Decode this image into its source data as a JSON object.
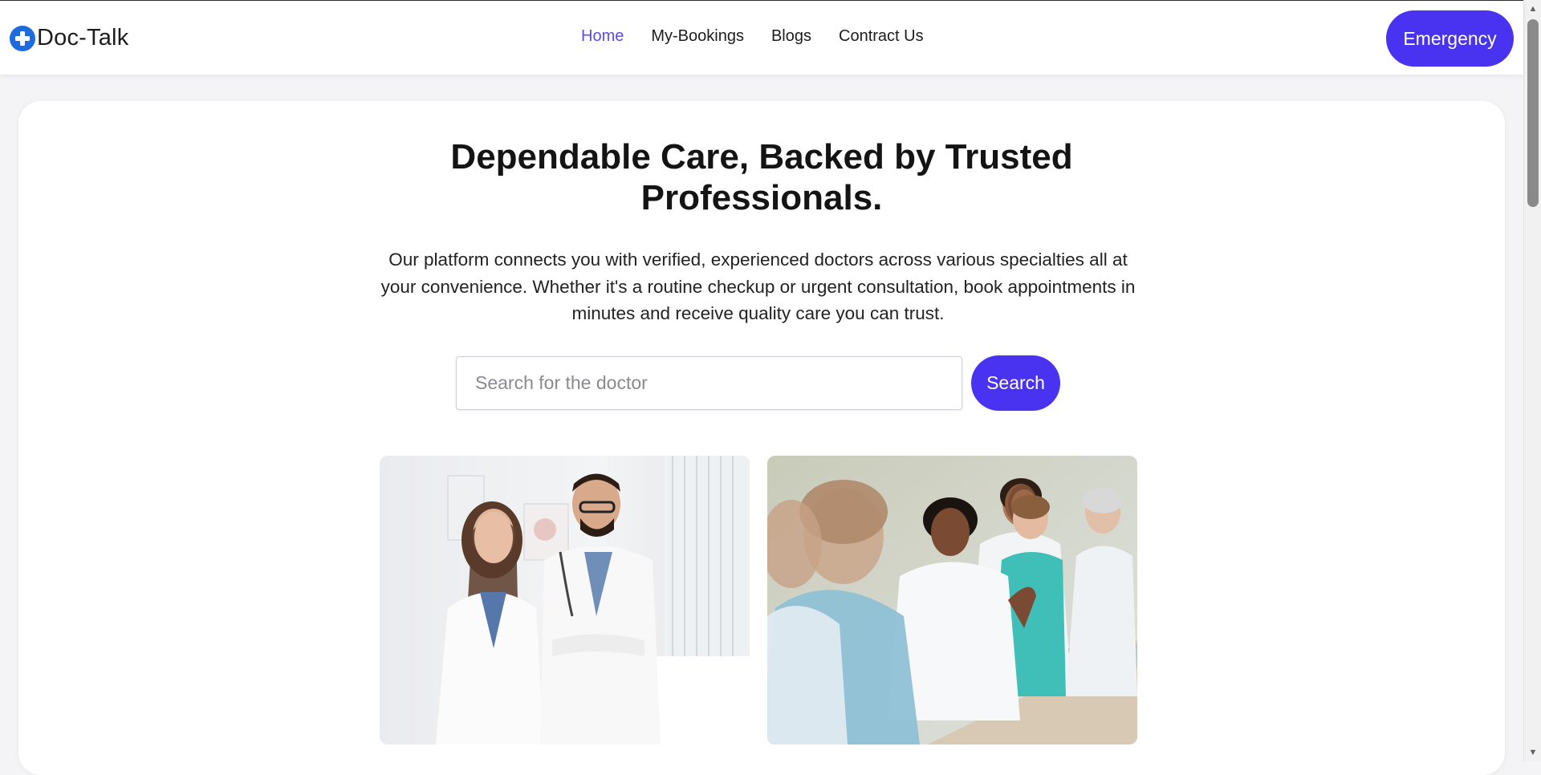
{
  "brand": {
    "name": "Doc-Talk",
    "icon": "medical-cross-icon",
    "icon_color": "#1e6be0"
  },
  "nav": {
    "items": [
      {
        "label": "Home",
        "active": true
      },
      {
        "label": "My-Bookings",
        "active": false
      },
      {
        "label": "Blogs",
        "active": false
      },
      {
        "label": "Contract Us",
        "active": false
      }
    ],
    "active_color": "#5a4cf0"
  },
  "header": {
    "emergency_label": "Emergency"
  },
  "hero": {
    "title_line1": "Dependable Care, Backed by Trusted",
    "title_line2": "Professionals.",
    "description": "Our platform connects you with verified, experienced doctors across various specialties all at your convenience. Whether it's a routine checkup or urgent consultation, book appointments in minutes and receive quality care you can trust."
  },
  "search": {
    "placeholder": "Search for the doctor",
    "value": "",
    "button_label": "Search"
  },
  "images": [
    {
      "name": "two-doctors-photo"
    },
    {
      "name": "medical-team-meeting-photo"
    }
  ],
  "colors": {
    "accent": "#4a33f0",
    "background": "#f4f4f7",
    "card": "#ffffff"
  }
}
